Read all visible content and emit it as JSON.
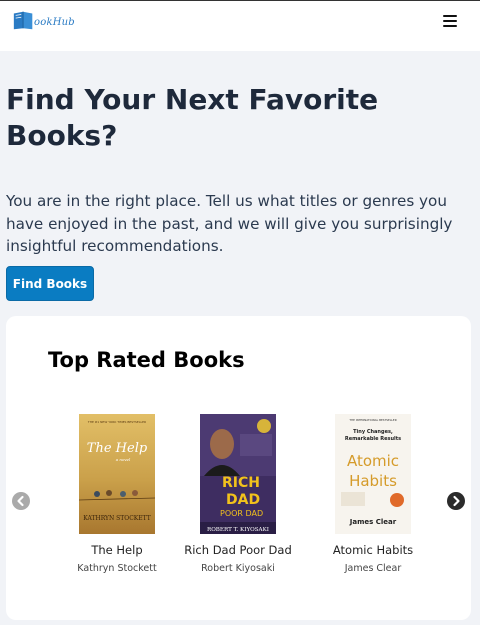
{
  "header": {
    "logo_text": "ookHub",
    "menu_icon": "hamburger-menu-icon"
  },
  "hero": {
    "title": "Find Your Next Favorite Books?",
    "description": "You are in the right place. Tell us what titles or genres you have enjoyed in the past, and we will give you surprisingly insightful recommendations.",
    "button_label": "Find Books"
  },
  "top_rated": {
    "heading": "Top Rated Books",
    "books": [
      {
        "title": "The Help",
        "author": "Kathryn Stockett",
        "cover": {
          "top_text": "THE #1 NEW YORK TIMES BESTSELLER",
          "title": "The Help",
          "subtitle": "a novel",
          "author": "KATHRYN STOCKETT"
        }
      },
      {
        "title": "Rich Dad Poor Dad",
        "author": "Robert Kiyosaki",
        "cover": {
          "title_line1": "RICH",
          "title_line2": "DAD",
          "title_line3": "POOR DAD",
          "author": "ROBERT T. KIYOSAKI"
        }
      },
      {
        "title": "Atomic Habits",
        "author": "James Clear",
        "cover": {
          "top_text": "THE INTERNATIONAL BESTSELLER",
          "tagline": "Tiny Changes, Remarkable Results",
          "title_line1": "Atomic",
          "title_line2": "Habits",
          "author": "James Clear"
        }
      }
    ],
    "prev_icon": "chevron-left-icon",
    "next_icon": "chevron-right-icon"
  },
  "colors": {
    "accent": "#0a7cc2",
    "page_bg": "#f1f3f7",
    "brand": "#2a7bc4"
  }
}
